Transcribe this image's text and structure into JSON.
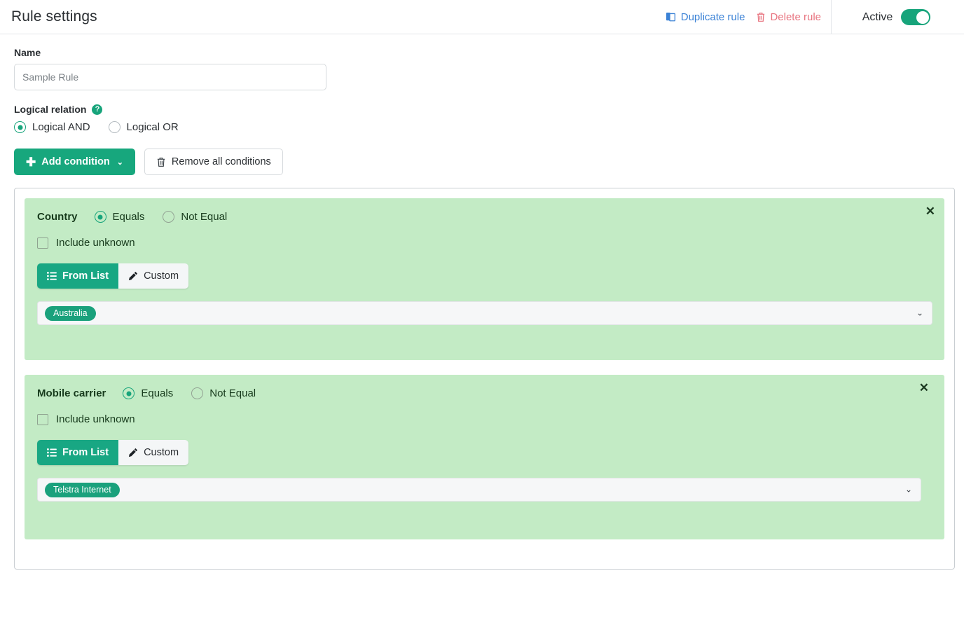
{
  "header": {
    "title": "Rule settings",
    "duplicate_label": "Duplicate rule",
    "delete_label": "Delete rule",
    "active_label": "Active",
    "toggle_state": "on",
    "duplicate_color": "#3b82d6",
    "delete_color": "#e8737f",
    "accent_color": "#17a47b"
  },
  "form": {
    "name_label": "Name",
    "name_value": "Sample Rule",
    "name_placeholder": "Sample Rule",
    "logical_relation_label": "Logical relation",
    "help_glyph": "?",
    "logical_options": [
      {
        "label": "Logical AND",
        "selected": true
      },
      {
        "label": "Logical OR",
        "selected": false
      }
    ],
    "add_condition_label": "Add condition",
    "add_condition_plus": "✚",
    "add_condition_caret": "⌄",
    "remove_all_label": "Remove all conditions"
  },
  "conditions": [
    {
      "title": "Country",
      "operators": [
        {
          "label": "Equals",
          "selected": true
        },
        {
          "label": "Not Equal",
          "selected": false
        }
      ],
      "include_unknown_label": "Include unknown",
      "include_unknown_checked": false,
      "source_tabs": [
        {
          "label": "From List",
          "active": true,
          "icon": "list-icon"
        },
        {
          "label": "Custom",
          "active": false,
          "icon": "pencil-icon"
        }
      ],
      "selected_values": [
        "Australia"
      ],
      "close_glyph": "✕",
      "caret_glyph": "⌄"
    },
    {
      "title": "Mobile carrier",
      "operators": [
        {
          "label": "Equals",
          "selected": true
        },
        {
          "label": "Not Equal",
          "selected": false
        }
      ],
      "include_unknown_label": "Include unknown",
      "include_unknown_checked": false,
      "source_tabs": [
        {
          "label": "From List",
          "active": true,
          "icon": "list-icon"
        },
        {
          "label": "Custom",
          "active": false,
          "icon": "pencil-icon"
        }
      ],
      "selected_values": [
        "Telstra Internet"
      ],
      "close_glyph": "✕",
      "caret_glyph": "⌄"
    }
  ],
  "colors": {
    "card_green": "#c3ebc5",
    "teal": "#17a77d",
    "tag_green": "#1aa17c"
  }
}
